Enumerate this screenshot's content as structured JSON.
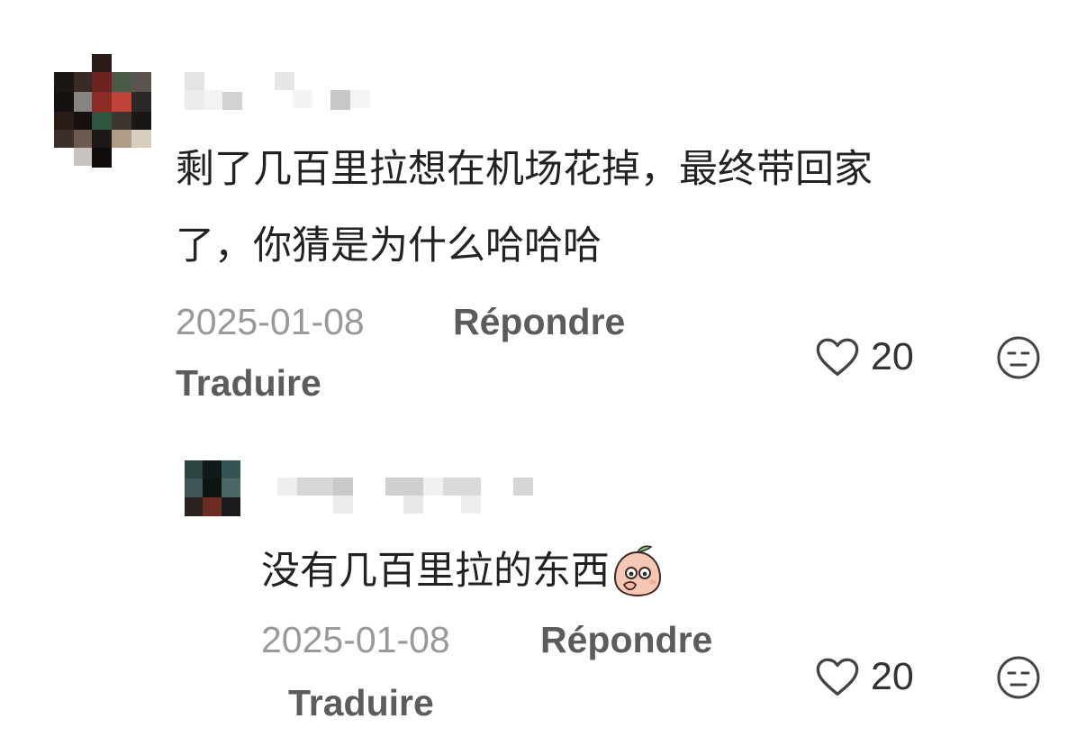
{
  "comments": [
    {
      "text_line1": "剩了几百里拉想在机场花掉，最终带回家",
      "text_line2": "了，你猜是为什么哈哈哈",
      "date": "2025-01-08",
      "reply_label": "Répondre",
      "translate_label": "Traduire",
      "like_count": "20"
    },
    {
      "text": "没有几百里拉的东西",
      "emoji": "peach-face-covering-mouth-emoji",
      "date": "2025-01-08",
      "reply_label": "Répondre",
      "translate_label": "Traduire",
      "like_count": "20"
    }
  ],
  "icons": {
    "like": "heart-outline-icon",
    "dislike": "expressionless-face-icon"
  },
  "colors": {
    "text": "#222222",
    "meta": "#999999",
    "action": "#5c5c5c"
  }
}
